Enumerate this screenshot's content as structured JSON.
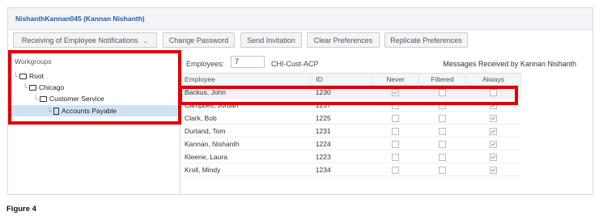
{
  "app": {
    "title": "NishanthKannan045 (Kannan Nishanth)"
  },
  "toolbar": {
    "notifications_label": "Receiving of Employee Notifications",
    "change_password_label": "Change Password",
    "send_invitation_label": "Send Invitation",
    "clear_preferences_label": "Clear Preferences",
    "replicate_preferences_label": "Replicate Preferences"
  },
  "sidebar": {
    "header": "Workgroups",
    "tree": [
      {
        "label": "Root",
        "level": 0,
        "type": "folder"
      },
      {
        "label": "Chicago",
        "level": 1,
        "type": "folder"
      },
      {
        "label": "Customer Service",
        "level": 2,
        "type": "folder"
      },
      {
        "label": "Accounts Payable",
        "level": 3,
        "type": "document",
        "selected": true
      }
    ]
  },
  "main": {
    "employees_label": "Employees:",
    "employees_count": "7",
    "group_name": "CHI-Cust-ACP",
    "messages_received": "Messages Received by Kannan Nishanth",
    "columns": [
      "Employee",
      "ID",
      "Never",
      "Filtered",
      "Always"
    ],
    "rows": [
      {
        "employee": "Backus, John",
        "id": "1230",
        "never": true,
        "filtered": false,
        "always": false,
        "disabled": true
      },
      {
        "employee": "Campbell, Jordan",
        "id": "1237",
        "never": false,
        "filtered": false,
        "always": true
      },
      {
        "employee": "Clark, Bob",
        "id": "1225",
        "never": false,
        "filtered": false,
        "always": true
      },
      {
        "employee": "Durland, Tom",
        "id": "1231",
        "never": false,
        "filtered": false,
        "always": true
      },
      {
        "employee": "Kannan, Nishanth",
        "id": "1224",
        "never": false,
        "filtered": false,
        "always": true
      },
      {
        "employee": "Kleene, Laura",
        "id": "1223",
        "never": false,
        "filtered": false,
        "always": true
      },
      {
        "employee": "Kroll, Mindy",
        "id": "1234",
        "never": false,
        "filtered": false,
        "always": true
      }
    ]
  },
  "caption": "Figure 4",
  "colors": {
    "highlight_red": "#e00000",
    "title_blue": "#1f5fa8",
    "selected_bg": "#cfe3f5"
  }
}
